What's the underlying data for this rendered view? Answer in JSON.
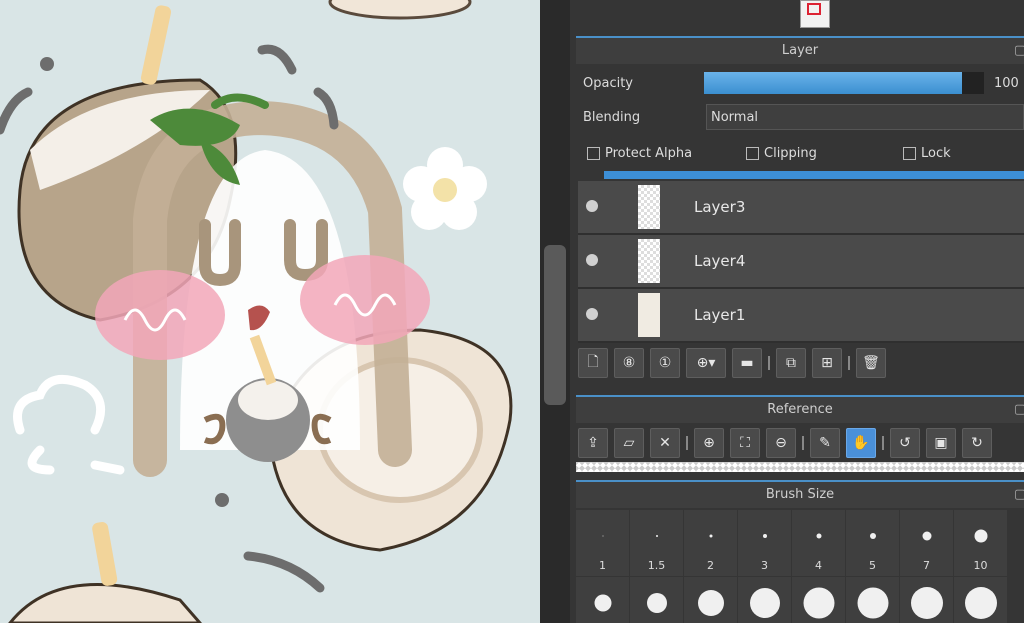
{
  "layer_panel": {
    "title": "Layer",
    "opacity_label": "Opacity",
    "opacity_value": "100",
    "opacity_fraction": 0.92,
    "blending_label": "Blending",
    "blending_value": "Normal",
    "protect_alpha": "Protect Alpha",
    "clipping": "Clipping",
    "lock": "Lock",
    "layers": [
      {
        "name": "Layer3"
      },
      {
        "name": "Layer4"
      },
      {
        "name": "Layer1"
      }
    ]
  },
  "reference_panel": {
    "title": "Reference"
  },
  "brush_panel": {
    "title": "Brush Size",
    "sizes": [
      "1",
      "1.5",
      "2",
      "3",
      "4",
      "5",
      "7",
      "10"
    ]
  },
  "colors": {
    "accent": "#4a90d9",
    "panel_bg": "#353535",
    "canvas_bg": "#d9e5e6"
  }
}
